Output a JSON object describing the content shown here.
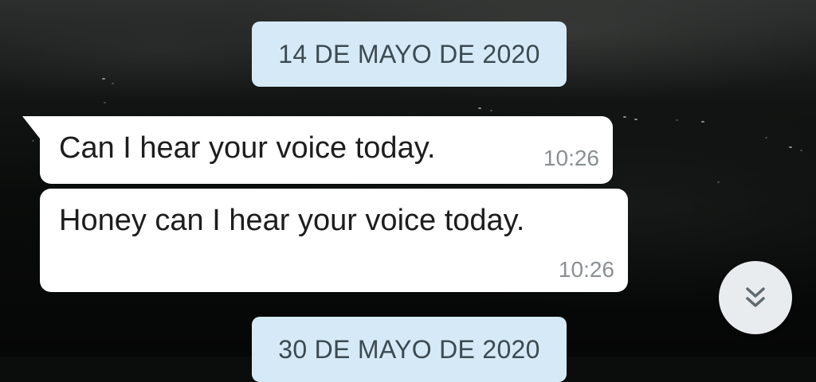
{
  "chat": {
    "date_separators": [
      {
        "label": "14 DE MAYO DE 2020"
      },
      {
        "label": "30 DE MAYO DE 2020"
      }
    ],
    "messages": [
      {
        "text": "Can I hear your voice today.",
        "time": "10:26"
      },
      {
        "text": "Honey can I hear your voice today.",
        "time": "10:26"
      }
    ]
  },
  "scroll_button": {
    "icon": "double-chevron-down-icon"
  },
  "colors": {
    "date_chip_bg": "#d5eaf6",
    "bubble_bg": "#ffffff",
    "time_text": "#8a8f92",
    "scroll_button_bg": "#e9ecee"
  }
}
